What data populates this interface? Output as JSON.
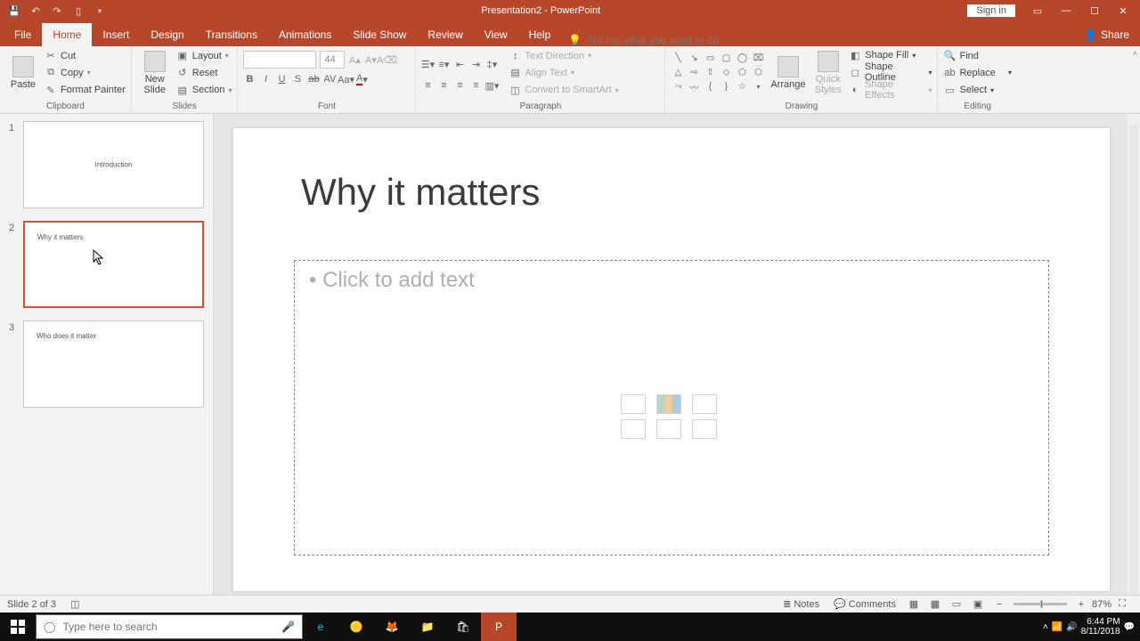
{
  "titlebar": {
    "title": "Presentation2 - PowerPoint",
    "signin": "Sign in"
  },
  "tabs": {
    "file": "File",
    "home": "Home",
    "insert": "Insert",
    "design": "Design",
    "transitions": "Transitions",
    "animations": "Animations",
    "slideshow": "Slide Show",
    "review": "Review",
    "view": "View",
    "help": "Help",
    "tellme_placeholder": "Tell me what you want to do",
    "share": "Share"
  },
  "ribbon": {
    "clipboard": {
      "label": "Clipboard",
      "paste": "Paste",
      "cut": "Cut",
      "copy": "Copy",
      "format_painter": "Format Painter"
    },
    "slides": {
      "label": "Slides",
      "new_slide": "New\nSlide",
      "layout": "Layout",
      "reset": "Reset",
      "section": "Section"
    },
    "font": {
      "label": "Font",
      "size": "44"
    },
    "paragraph": {
      "label": "Paragraph",
      "text_direction": "Text Direction",
      "align_text": "Align Text",
      "convert_smartart": "Convert to SmartArt"
    },
    "drawing": {
      "label": "Drawing",
      "arrange": "Arrange",
      "quick_styles": "Quick\nStyles",
      "shape_fill": "Shape Fill",
      "shape_outline": "Shape Outline",
      "shape_effects": "Shape Effects"
    },
    "editing": {
      "label": "Editing",
      "find": "Find",
      "replace": "Replace",
      "select": "Select"
    }
  },
  "thumbnails": [
    {
      "num": "1",
      "title": "Introduction",
      "selected": false,
      "layout": "title"
    },
    {
      "num": "2",
      "title": "Why it matters",
      "selected": true,
      "layout": "content"
    },
    {
      "num": "3",
      "title": "Who does it matter",
      "selected": false,
      "layout": "content"
    }
  ],
  "slide": {
    "title": "Why it matters",
    "content_placeholder": "Click to add text"
  },
  "status": {
    "slide_info": "Slide 2 of 3",
    "notes": "Notes",
    "comments": "Comments",
    "zoom": "87%"
  },
  "taskbar": {
    "search_placeholder": "Type here to search",
    "time": "6:44 PM",
    "date": "8/11/2018"
  }
}
